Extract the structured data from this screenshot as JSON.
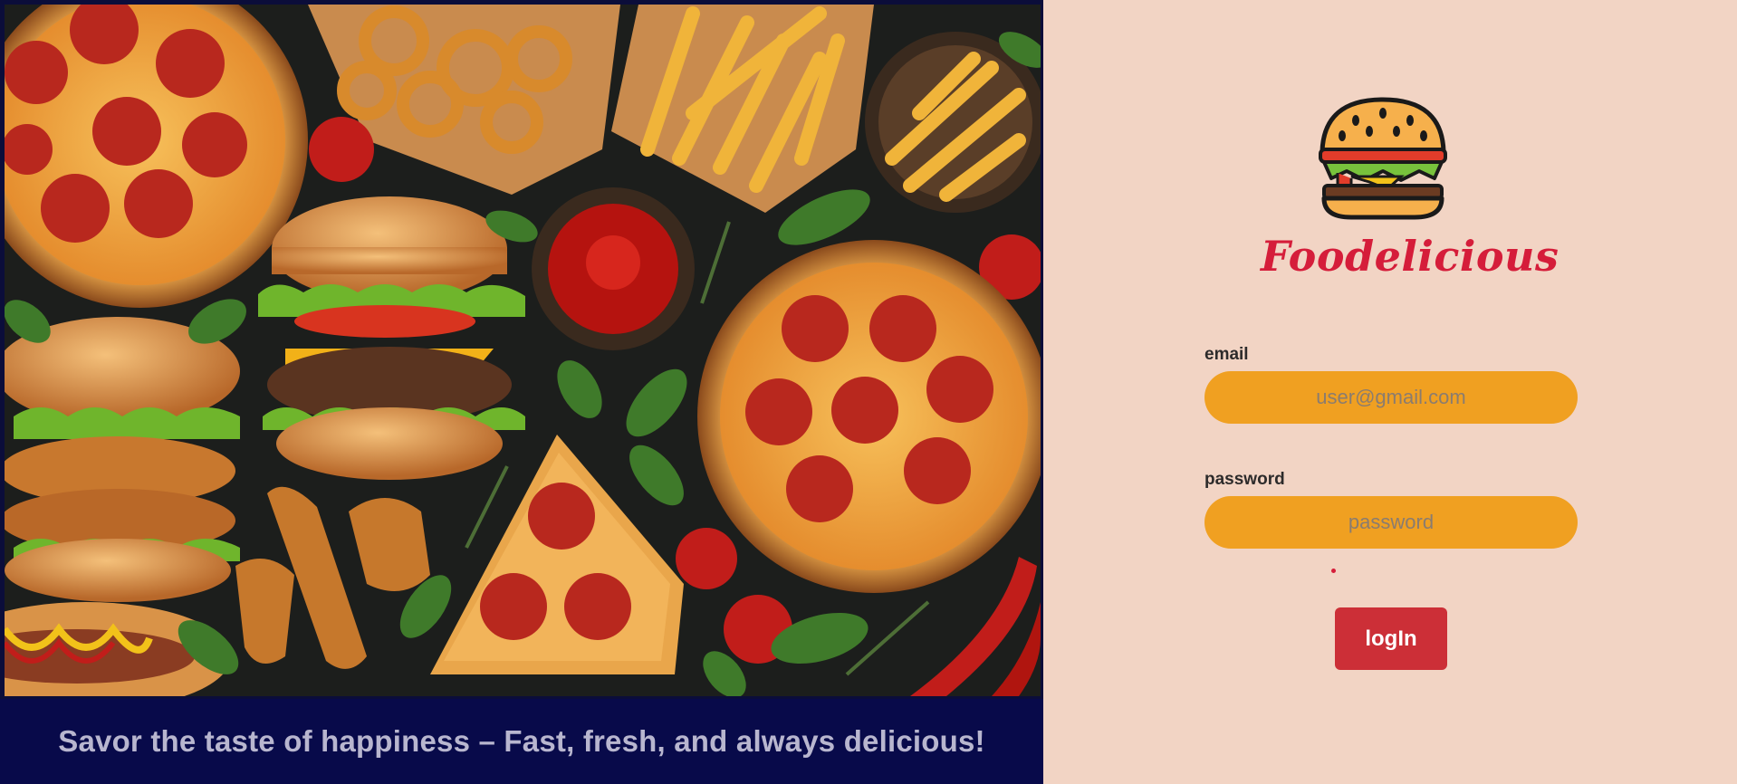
{
  "hero": {
    "image_alt": "food-collage",
    "tagline": "Savor the taste of happiness – Fast, fresh, and always delicious!"
  },
  "brand": {
    "logo_icon": "burger-icon",
    "name": "Foodelicious",
    "accent_color": "#d51d3a"
  },
  "form": {
    "email": {
      "label": "email",
      "placeholder": "user@gmail.com",
      "value": ""
    },
    "password": {
      "label": "password",
      "placeholder": "password",
      "value": ""
    },
    "error_text": "",
    "submit_label": "logIn"
  },
  "colors": {
    "panel_bg": "#f2d4c4",
    "input_bg": "#f0a021",
    "button_bg": "#cc2f37",
    "tagline_bar": "#080a4a"
  }
}
